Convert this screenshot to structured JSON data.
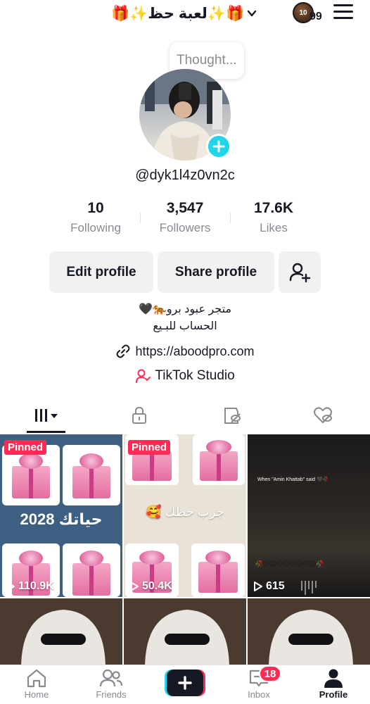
{
  "header": {
    "account_name": "🎁✨لعبة حظ✨🎁",
    "coin_label": "10",
    "coin_count": "99"
  },
  "profile": {
    "thought_placeholder": "Thought...",
    "username": "@dyk1l4z0vn2c"
  },
  "stats": [
    {
      "value": "10",
      "label": "Following"
    },
    {
      "value": "3,547",
      "label": "Followers"
    },
    {
      "value": "17.6K",
      "label": "Likes"
    }
  ],
  "actions": {
    "edit_profile": "Edit profile",
    "share_profile": "Share profile"
  },
  "bio": {
    "line1": "متجر عبود برو🐅🖤",
    "line2": "الحساب للبـيع",
    "link": "https://aboodpro.com",
    "studio": "TikTok Studio"
  },
  "videos": [
    {
      "pinned_label": "Pinned",
      "views": "110.9K",
      "caption": "حياتك 2028"
    },
    {
      "pinned_label": "Pinned",
      "views": "50.4K",
      "caption": "جرب حظك 🥰"
    },
    {
      "views": "615",
      "caption": "When \"Amin Khattab\" said 🖤🥀",
      "emoji_row": "🥀😖😖😖😖😖😖😖😖🥀"
    }
  ],
  "nav": {
    "home": "Home",
    "friends": "Friends",
    "inbox": "Inbox",
    "inbox_badge": "18",
    "profile": "Profile"
  },
  "colors": {
    "accent_red": "#fe2c55",
    "accent_cyan": "#20d5ec",
    "muted_text": "#8a8b91"
  }
}
